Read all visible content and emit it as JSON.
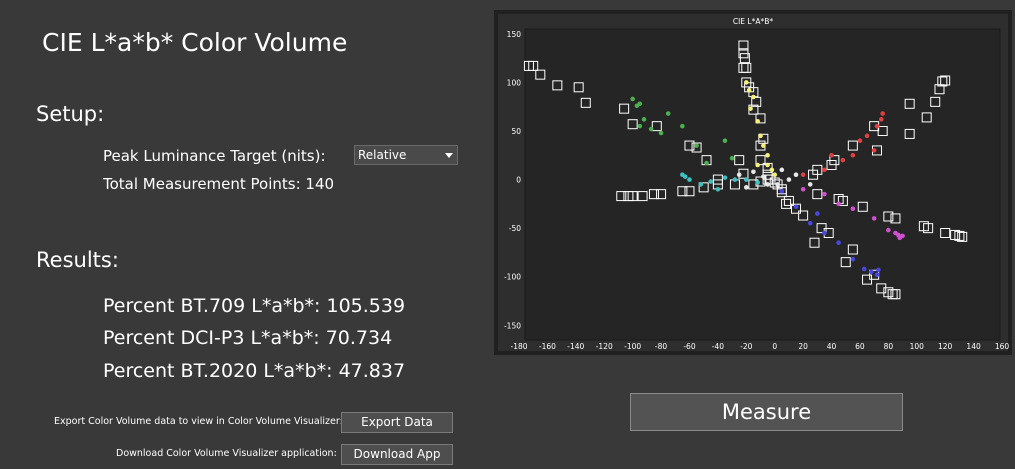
{
  "page": {
    "title": "CIE L*a*b* Color Volume",
    "setup_heading": "Setup:",
    "peak_label": "Peak Luminance Target (nits):",
    "peak_value": "Relative",
    "total_label": "Total Measurement Points: 140",
    "results_heading": "Results:",
    "result_bt709": "Percent BT.709 L*a*b*: 105.539",
    "result_dcip3": "Percent DCI-P3 L*a*b*: 70.734",
    "result_bt2020": "Percent BT.2020 L*a*b*: 47.837",
    "export_label": "Export Color Volume data to view in Color Volume Visualizer:",
    "export_button": "Export Data",
    "download_label": "Download Color Volume Visualizer application:",
    "download_button": "Download App",
    "measure_button": "Measure"
  },
  "colors": {
    "background": "#393939",
    "chart_bg": "#2e2e2e",
    "chart_frame": "#202020"
  },
  "chart_data": {
    "type": "scatter",
    "title": "CIE L*A*B*",
    "xlabel": "",
    "ylabel": "",
    "xlim": [
      -180,
      160
    ],
    "ylim": [
      -160,
      155
    ],
    "x_ticks": [
      -180,
      -160,
      -140,
      -120,
      -100,
      -80,
      -60,
      -40,
      -20,
      0,
      20,
      40,
      60,
      80,
      100,
      120,
      140,
      160
    ],
    "y_ticks": [
      150,
      100,
      50,
      0,
      -50,
      -100,
      -150
    ],
    "grid": false,
    "series": [
      {
        "marker": "square",
        "points": [
          [
            -173,
            117
          ],
          [
            -170,
            117
          ],
          [
            -165,
            108
          ],
          [
            -153,
            97
          ],
          [
            -138,
            95
          ],
          [
            -133,
            79
          ],
          [
            -106,
            73
          ],
          [
            -100,
            57
          ],
          [
            -83,
            55
          ],
          [
            -60,
            35
          ],
          [
            -55,
            33
          ],
          [
            -48,
            20
          ],
          [
            -25,
            20
          ],
          [
            -22,
            6
          ],
          [
            -40,
            0
          ],
          [
            -22,
            138
          ],
          [
            -22,
            130
          ],
          [
            -21,
            125
          ],
          [
            -22,
            115
          ],
          [
            -20,
            115
          ],
          [
            -20,
            100
          ],
          [
            -18,
            95
          ],
          [
            -15,
            90
          ],
          [
            -13,
            80
          ],
          [
            -15,
            72
          ],
          [
            -10,
            63
          ],
          [
            -8,
            42
          ],
          [
            -10,
            35
          ],
          [
            -10,
            20
          ],
          [
            -5,
            12
          ],
          [
            -5,
            5
          ],
          [
            -3,
            0
          ],
          [
            -108,
            -17
          ],
          [
            -103,
            -17
          ],
          [
            -100,
            -17
          ],
          [
            -93,
            -17
          ],
          [
            -85,
            -15
          ],
          [
            -80,
            -15
          ],
          [
            -65,
            -12
          ],
          [
            -60,
            -12
          ],
          [
            -50,
            -8
          ],
          [
            -40,
            -5
          ],
          [
            -28,
            -5
          ],
          [
            -15,
            -5
          ],
          [
            -10,
            -2
          ],
          [
            -5,
            0
          ],
          [
            0,
            -3
          ],
          [
            2,
            -5
          ],
          [
            5,
            -10
          ],
          [
            10,
            -22
          ],
          [
            15,
            -30
          ],
          [
            20,
            -37
          ],
          [
            28,
            -65
          ],
          [
            33,
            -50
          ],
          [
            38,
            -55
          ],
          [
            50,
            -85
          ],
          [
            55,
            -72
          ],
          [
            65,
            -103
          ],
          [
            70,
            -98
          ],
          [
            75,
            -112
          ],
          [
            80,
            -116
          ],
          [
            83,
            -118
          ],
          [
            85,
            -118
          ],
          [
            5,
            -13
          ],
          [
            8,
            -25
          ],
          [
            30,
            -15
          ],
          [
            45,
            -20
          ],
          [
            48,
            -22
          ],
          [
            62,
            -28
          ],
          [
            80,
            -38
          ],
          [
            85,
            -40
          ],
          [
            105,
            -48
          ],
          [
            108,
            -50
          ],
          [
            120,
            -55
          ],
          [
            127,
            -57
          ],
          [
            130,
            -58
          ],
          [
            132,
            -59
          ],
          [
            27,
            5
          ],
          [
            30,
            10
          ],
          [
            40,
            15
          ],
          [
            42,
            20
          ],
          [
            55,
            35
          ],
          [
            70,
            55
          ],
          [
            72,
            30
          ],
          [
            76,
            50
          ],
          [
            95,
            47
          ],
          [
            95,
            78
          ],
          [
            107,
            64
          ],
          [
            113,
            80
          ],
          [
            116,
            93
          ],
          [
            118,
            101
          ],
          [
            120,
            102
          ]
        ]
      },
      {
        "marker": "dot",
        "color": "#4caf50",
        "points": [
          [
            -100,
            83
          ],
          [
            -97,
            76
          ],
          [
            -95,
            78
          ],
          [
            -92,
            62
          ],
          [
            -87,
            52
          ],
          [
            -75,
            68
          ],
          [
            -65,
            55
          ],
          [
            -55,
            35
          ],
          [
            -48,
            17
          ],
          [
            -35,
            40
          ],
          [
            -30,
            22
          ],
          [
            -95,
            55
          ],
          [
            -80,
            48
          ]
        ]
      },
      {
        "marker": "dot",
        "color": "#f5f07a",
        "points": [
          [
            -20,
            100
          ],
          [
            -18,
            92
          ],
          [
            -15,
            85
          ],
          [
            -17,
            73
          ],
          [
            -12,
            60
          ],
          [
            -10,
            45
          ],
          [
            -8,
            35
          ],
          [
            -5,
            25
          ],
          [
            -5,
            15
          ],
          [
            -2,
            10
          ],
          [
            0,
            5
          ],
          [
            -12,
            15
          ]
        ]
      },
      {
        "marker": "dot",
        "color": "#40c0c0",
        "points": [
          [
            -65,
            5
          ],
          [
            -63,
            3
          ],
          [
            -60,
            0
          ],
          [
            -52,
            -5
          ],
          [
            -45,
            -2
          ],
          [
            -40,
            -10
          ],
          [
            -35,
            2
          ],
          [
            -28,
            0
          ],
          [
            -20,
            0
          ],
          [
            -12,
            -3
          ]
        ]
      },
      {
        "marker": "dot",
        "color": "#4848e0",
        "points": [
          [
            5,
            -12
          ],
          [
            15,
            -28
          ],
          [
            25,
            -45
          ],
          [
            35,
            -55
          ],
          [
            45,
            -65
          ],
          [
            55,
            -82
          ],
          [
            63,
            -92
          ],
          [
            68,
            -95
          ],
          [
            72,
            -98
          ],
          [
            73,
            -93
          ],
          [
            30,
            -35
          ]
        ]
      },
      {
        "marker": "dot",
        "color": "#d050d0",
        "points": [
          [
            20,
            -10
          ],
          [
            35,
            -15
          ],
          [
            45,
            -25
          ],
          [
            55,
            -30
          ],
          [
            70,
            -40
          ],
          [
            80,
            -52
          ],
          [
            85,
            -55
          ],
          [
            87,
            -57
          ],
          [
            88,
            -60
          ],
          [
            90,
            -58
          ]
        ]
      },
      {
        "marker": "dot",
        "color": "#e04040",
        "points": [
          [
            20,
            5
          ],
          [
            35,
            10
          ],
          [
            48,
            20
          ],
          [
            55,
            25
          ],
          [
            60,
            40
          ],
          [
            65,
            45
          ],
          [
            72,
            55
          ],
          [
            75,
            62
          ],
          [
            76,
            68
          ],
          [
            70,
            30
          ],
          [
            40,
            25
          ]
        ]
      },
      {
        "marker": "dot",
        "color": "#e8e8e8",
        "points": [
          [
            -25,
            5
          ],
          [
            -15,
            8
          ],
          [
            -8,
            3
          ],
          [
            -5,
            -5
          ],
          [
            2,
            -5
          ],
          [
            10,
            0
          ],
          [
            15,
            5
          ],
          [
            25,
            -5
          ],
          [
            -20,
            -8
          ],
          [
            5,
            10
          ]
        ]
      }
    ]
  }
}
